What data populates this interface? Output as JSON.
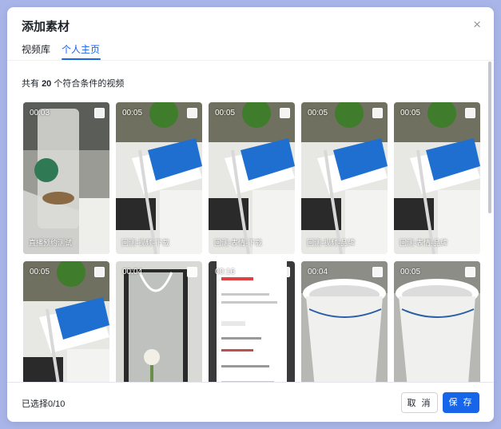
{
  "dialog": {
    "title": "添加素材",
    "close_symbol": "×",
    "tabs": [
      {
        "label": "视频库",
        "active": false
      },
      {
        "label": "个人主页",
        "active": true
      }
    ],
    "summary": {
      "prefix": "共有",
      "count": "20",
      "suffix": "个符合条件的视频"
    },
    "videos": [
      {
        "duration": "00:03",
        "name": "直播预约测试",
        "theme": "cup"
      },
      {
        "duration": "00:05",
        "name": "回测-视频-下载",
        "theme": "tissue"
      },
      {
        "duration": "00:05",
        "name": "回测-表情-下载",
        "theme": "tissue"
      },
      {
        "duration": "00:05",
        "name": "回测-视频-品牌",
        "theme": "tissue"
      },
      {
        "duration": "00:05",
        "name": "回测-表情-品牌",
        "theme": "tissue"
      },
      {
        "duration": "00:05",
        "name": "",
        "theme": "tissue"
      },
      {
        "duration": "00:04",
        "name": "",
        "theme": "bag"
      },
      {
        "duration": "00:16",
        "name": "",
        "theme": "phone"
      },
      {
        "duration": "00:04",
        "name": "",
        "theme": "bin"
      },
      {
        "duration": "00:05",
        "name": "",
        "theme": "bin"
      }
    ],
    "footer": {
      "selected_text": "已选择0/10",
      "cancel_label": "取 消",
      "save_label": "保 存"
    },
    "colors": {
      "accent": "#1765e8",
      "backdrop": "#a9b5e8"
    }
  }
}
